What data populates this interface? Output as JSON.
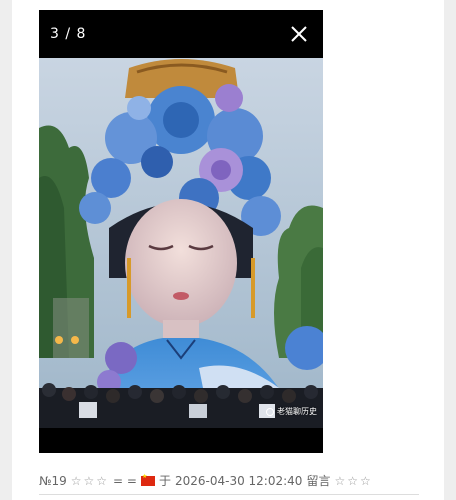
{
  "viewer": {
    "counter": "3 / 8",
    "watermark": "老猫聊历史"
  },
  "comment_meta": {
    "number": "№19",
    "rating_left": "☆☆☆",
    "equals": "= =",
    "flag": "cn-flag",
    "word_at": "于",
    "timestamp": "2026-04-30 12:02:40",
    "suffix": "留言",
    "rating_right": "☆☆☆"
  },
  "colors": {
    "viewer_bg": "#000000",
    "flag_red": "#de2910",
    "flag_yellow": "#ffde00"
  }
}
